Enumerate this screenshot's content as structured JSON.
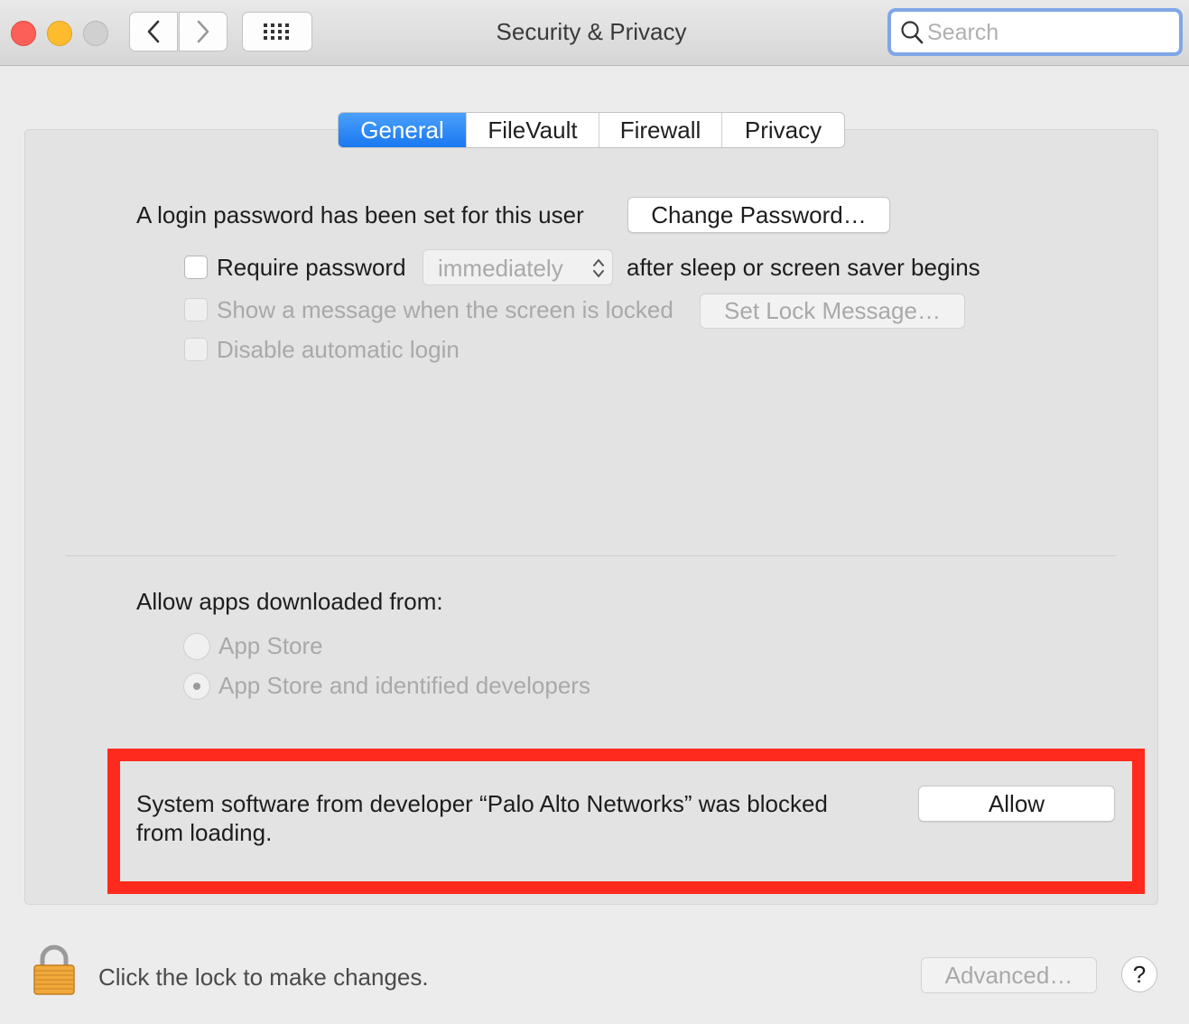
{
  "window": {
    "title": "Security & Privacy",
    "search_placeholder": "Search"
  },
  "tabs": [
    {
      "label": "General",
      "active": true
    },
    {
      "label": "FileVault",
      "active": false
    },
    {
      "label": "Firewall",
      "active": false
    },
    {
      "label": "Privacy",
      "active": false
    }
  ],
  "general": {
    "login_text": "A login password has been set for this user",
    "change_password_button": "Change Password…",
    "require_password_label": "Require password",
    "require_password_checked": false,
    "require_password_value": "immediately",
    "after_sleep_text": "after sleep or screen saver begins",
    "show_message_label": "Show a message when the screen is locked",
    "set_lock_message_button": "Set Lock Message…",
    "disable_autologin_label": "Disable automatic login",
    "allow_apps_heading": "Allow apps downloaded from:",
    "radio_options": [
      {
        "label": "App Store",
        "selected": false
      },
      {
        "label": "App Store and identified developers",
        "selected": true
      }
    ],
    "blocked_message_line1": "System software from developer “Palo Alto Networks” was blocked",
    "blocked_message_line2": "from loading.",
    "allow_button": "Allow"
  },
  "footer": {
    "lock_text": "Click the lock to make changes.",
    "advanced_button": "Advanced…",
    "help_button": "?"
  },
  "colors": {
    "accent": "#1a78f0",
    "highlight_border": "#ff2a1e"
  }
}
